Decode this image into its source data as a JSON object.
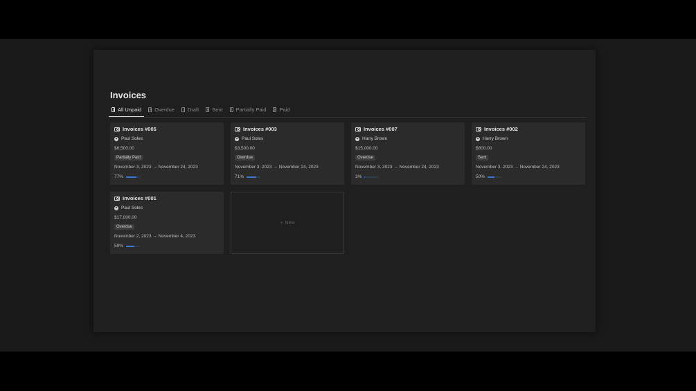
{
  "page": {
    "title": "Invoices"
  },
  "tabs": [
    {
      "label": "All Unpaid",
      "active": true
    },
    {
      "label": "Overdue",
      "active": false
    },
    {
      "label": "Draft",
      "active": false
    },
    {
      "label": "Sent",
      "active": false
    },
    {
      "label": "Partially Paid",
      "active": false
    },
    {
      "label": "Paid",
      "active": false
    }
  ],
  "cards": [
    {
      "title": "Invoices #005",
      "person": "Paul Soles",
      "amount": "$6,500.00",
      "status": "Partially Paid",
      "dates": "November 3, 2023 → November 24, 2023",
      "progress_label": "77%",
      "progress": 0.77
    },
    {
      "title": "Invoices #003",
      "person": "Paul Soles",
      "amount": "$3,500.00",
      "status": "Overdue",
      "dates": "November 3, 2023 → November 24, 2023",
      "progress_label": "71%",
      "progress": 0.71
    },
    {
      "title": "Invoices #007",
      "person": "Harry Brown",
      "amount": "$15,000.00",
      "status": "Overdue",
      "dates": "November 3, 2023 → November 24, 2023",
      "progress_label": "3%",
      "progress": 0.03
    },
    {
      "title": "Invoices #002",
      "person": "Harry Brown",
      "amount": "$800.00",
      "status": "Sent",
      "dates": "November 3, 2023 → November 24, 2023",
      "progress_label": "50%",
      "progress": 0.5
    },
    {
      "title": "Invoices #001",
      "person": "Paul Soles",
      "amount": "$17,000.00",
      "status": "Overdue",
      "dates": "November 2, 2023 → November 4, 2023",
      "progress_label": "59%",
      "progress": 0.59
    }
  ],
  "new_card": {
    "label": "New",
    "icon": "+"
  },
  "colors": {
    "progress": "#3b7bd6",
    "background": "#1f1f1f",
    "card": "#2b2b2b"
  }
}
